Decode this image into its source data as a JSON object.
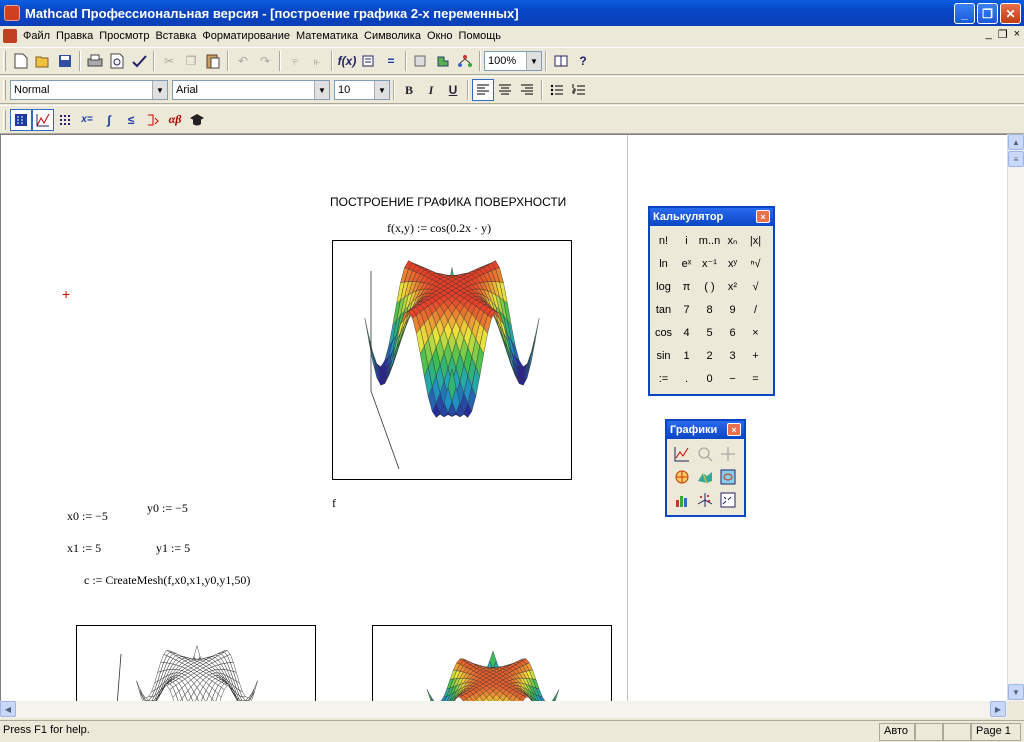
{
  "window": {
    "title": "Mathcad Профессиональная версия - [построение графика 2-х переменных]",
    "min": "_",
    "max": "❐",
    "close": "✕"
  },
  "menu": [
    "Файл",
    "Правка",
    "Просмотр",
    "Вставка",
    "Форматирование",
    "Математика",
    "Символика",
    "Окно",
    "Помощь"
  ],
  "mdi": {
    "min": "_",
    "restore": "❐",
    "close": "×"
  },
  "toolbar1": {
    "zoom": "100%"
  },
  "toolbar2": {
    "style": "Normal",
    "font": "Arial",
    "size": "10",
    "bold": "B",
    "italic": "I",
    "underline": "U"
  },
  "document": {
    "heading": "ПОСТРОЕНИЕ ГРАФИКА ПОВЕРХНОСТИ",
    "func_def": "f(x,y) := cos(0.2x · y)",
    "plot_label": "f",
    "x0": "x0 := −5",
    "y0": "y0 := −5",
    "x1": "x1 := 5",
    "y1": "y1 := 5",
    "mesh": "c := CreateMesh(f,x0,x1,y0,y1,50)",
    "cursor": "+"
  },
  "calculator": {
    "title": "Калькулятор",
    "close": "×",
    "keys": [
      "n!",
      "i",
      "m..n",
      "xₙ",
      "|x|",
      "ln",
      "eˣ",
      "x⁻¹",
      "xʸ",
      "ⁿ√",
      "log",
      "π",
      "( )",
      "x²",
      "√",
      "tan",
      "7",
      "8",
      "9",
      "/",
      "cos",
      "4",
      "5",
      "6",
      "×",
      "sin",
      "1",
      "2",
      "3",
      "+",
      ":=",
      ".",
      "0",
      "−",
      "="
    ]
  },
  "graphs": {
    "title": "Графики",
    "close": "×"
  },
  "status": {
    "help": "Press F1 for help.",
    "mode": "Авто",
    "page": "Page 1"
  }
}
